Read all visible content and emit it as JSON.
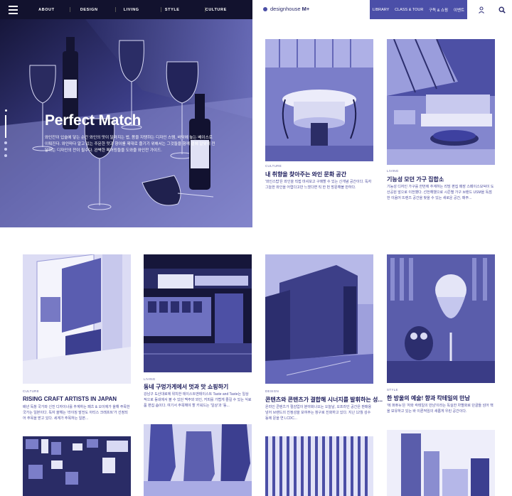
{
  "topnav": {
    "items": [
      "ABOUT",
      "DESIGN",
      "LIVING",
      "STYLE",
      "CULTURE"
    ]
  },
  "brand": {
    "name_prefix": "designhouse",
    "name_suffix": "M+"
  },
  "header_tabs": [
    "LIBRARY",
    "CLASS & TOUR",
    "구독 & 쇼핑",
    "이벤트"
  ],
  "icons": {
    "menu": "hamburger-icon",
    "user": "user-icon",
    "search": "search-icon"
  },
  "hero": {
    "title": "Perfect Match",
    "description": "와인잔이 입술에 닿는 순간 와인의 맛이 달라지는 법, 몸을 지탱하는 디자인 스템, 바닥에 놓는 베이스로 이뤄진다. 와인마다 알고 있는 주문한 맛과 향이를 제대로 즐기기 위해서는 그것들을 함께 곁에 알맞게 전달하는 디자인의 잔이 필수다. 완벽한 페어링들을 도와줄 와인잔 가이드."
  },
  "cards": [
    {
      "category": "CULTURE",
      "title": "내 취향을 찾아주는 와인 문화 공간",
      "desc": "'와인스탑'은 와인을 직접 마셔보고 구매할 수 있는 신개념 공간이다. 독자 그늘한 와인을 어렵다고만 느꼈다면 직 한 번 방문해볼 만하다."
    },
    {
      "category": "LIVING",
      "title": "기능성 모던 가구 집합소",
      "desc": "기능성 디자인 가구를 한번에 추계하는 리빙 편집 매장 스페이스모덕이 도산공원 앞으로 이전했다. 선전해했으로 시즌별 가구 브랜드 USM을 독점한 이음어 뜨렌즈 공간을 찾을 수 있는 새로운 공간, 매주..."
    },
    {
      "category": "CULTURE",
      "title": "RISING CRAFT ARTISTS IN JAPAN",
      "desc": "배년 독창 국가와 신진 디자이너를 추계하는 페츠 & 오이에가 올해 주목한 국가는 일본이다. 독자 올해는 '라이징 발전도 아티스 크래프트'가 선정되어 주목을 받고 있다. 세계가 주목하는 일본..."
    },
    {
      "category": "LIVING",
      "title": "동네 구멍가게에서 멋과 맛 쇼핑하기",
      "desc": "강남구 도산대로에 위치한 테이스트앤테이스트 Taste and Taste는 일상적으로 동네에서 볼 수 있던 맥주와 와인, 커피를 가볍게 즐길 수 있는 식료품 편집 숍이다. 여기서 주목해야 할 키워드는 '일상'과 '동..."
    },
    {
      "category": "DESIGN",
      "title": "콘텐츠와 콘텐츠가 결합해 시너지를 발휘하는 성...",
      "desc": "온라인 콘텐츠가 절감업이 분야화나오는 오늘날, 오프라인 공간은 판매용 넘어 브랜드의 진정성을 보여주는 창구로 진화하고 있다. 지난 12월 성수동에 문을 연 LCDC..."
    },
    {
      "category": "STYLE",
      "title": "한 방울의 예술! 향과 칵테일의 만남",
      "desc": "'에 퍼퓨뉴'은 '자와 칵테일의 만남'이라는 독실한 차별화로 단골들 넘어 핵을 보유하고 있는 바 이론적임의 새롭게 우린 공간이다."
    }
  ]
}
